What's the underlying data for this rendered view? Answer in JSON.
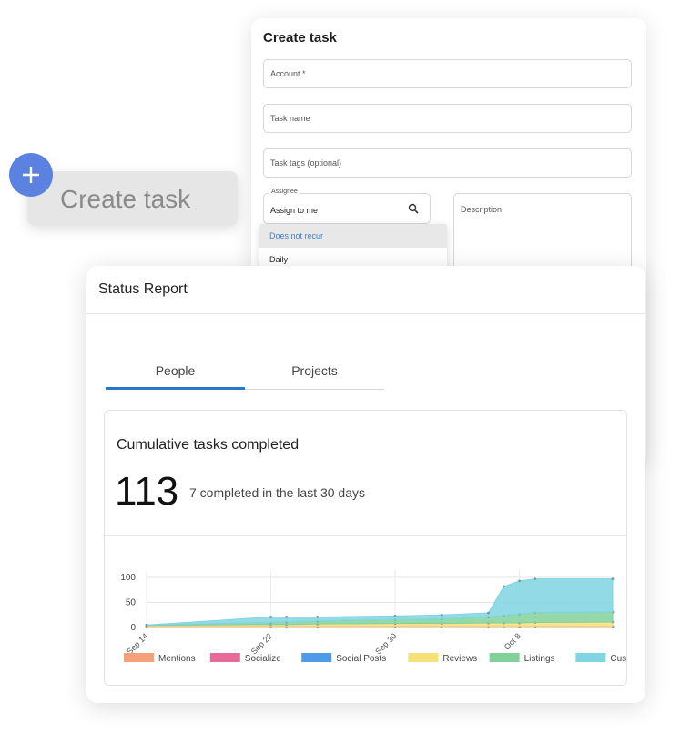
{
  "create_task_form": {
    "title": "Create task",
    "account_placeholder": "Account *",
    "task_name_placeholder": "Task name",
    "task_tags_placeholder": "Task tags (optional)",
    "assignee_label": "Assignee",
    "assignee_value": "Assign to me",
    "description_placeholder": "Description",
    "recurrence_options": [
      "Does not recur",
      "Daily"
    ]
  },
  "floating_button": {
    "label": "Create task",
    "icon": "plus-icon"
  },
  "status_report": {
    "title": "Status Report",
    "tabs": [
      "People",
      "Projects"
    ],
    "active_tab": "People",
    "card_title": "Cumulative tasks completed",
    "total": "113",
    "recent_text": "7 completed in the last 30 days"
  },
  "colors": {
    "accent": "#2a77c9",
    "plus_button": "#5b82e0",
    "selected_option_text": "#3b82d6"
  },
  "chart_data": {
    "type": "area",
    "x_tick_labels": [
      "Sep 14",
      "Sep 22",
      "Sep 30",
      "Oct 8"
    ],
    "x_tick_positions": [
      0,
      8,
      16,
      24
    ],
    "y_ticks": [
      0,
      50,
      100
    ],
    "ylim": [
      0,
      100
    ],
    "x": [
      0,
      8,
      9,
      11,
      16,
      19,
      22,
      23,
      24,
      25,
      30
    ],
    "series": [
      {
        "name": "Mentions",
        "color": "#f4a07b",
        "values": [
          1,
          1,
          1,
          1,
          1,
          1,
          1,
          1,
          1,
          1,
          1
        ]
      },
      {
        "name": "Socialize",
        "color": "#e86a9a",
        "values": [
          0,
          0,
          0,
          0,
          0,
          0,
          0,
          0,
          0,
          0,
          0
        ]
      },
      {
        "name": "Social Posts",
        "color": "#4f9be8",
        "values": [
          2,
          2,
          2,
          2,
          2,
          2,
          2,
          2,
          2,
          2,
          2
        ]
      },
      {
        "name": "Reviews",
        "color": "#f7df7a",
        "values": [
          1,
          3,
          3,
          4,
          5,
          5,
          6,
          6,
          6,
          7,
          8
        ]
      },
      {
        "name": "Listings",
        "color": "#82d19a",
        "values": [
          1,
          4,
          5,
          6,
          8,
          9,
          12,
          15,
          18,
          20,
          20
        ]
      },
      {
        "name": "Custom",
        "color": "#7fd5e2",
        "values": [
          0,
          11,
          10,
          8,
          7,
          8,
          8,
          58,
          66,
          67,
          66
        ]
      }
    ],
    "grid": true,
    "legend_position": "bottom"
  }
}
